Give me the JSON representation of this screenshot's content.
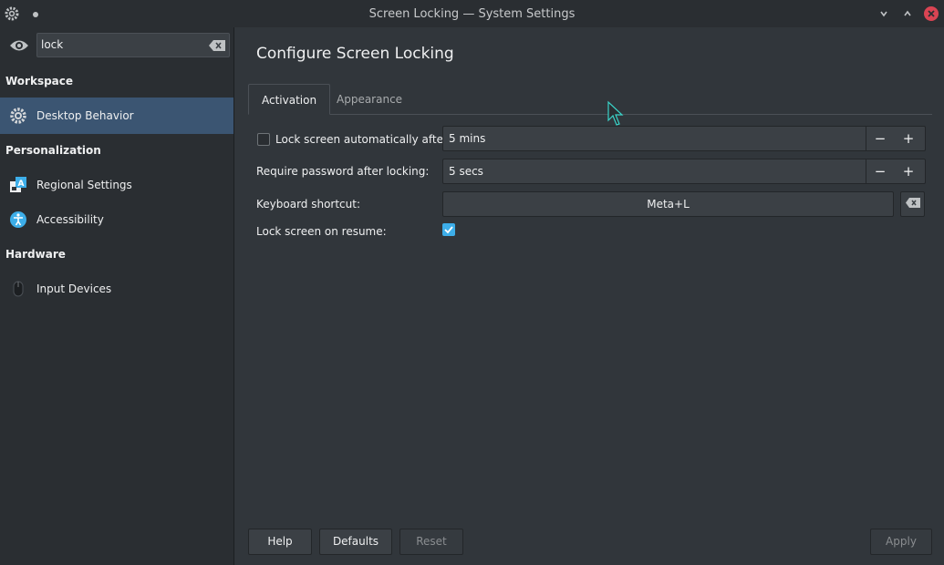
{
  "window": {
    "title": "Screen Locking — System Settings"
  },
  "search": {
    "value": "lock"
  },
  "sidebar": {
    "categories": [
      {
        "label": "Workspace"
      },
      {
        "label": "Personalization"
      },
      {
        "label": "Hardware"
      }
    ],
    "items": [
      {
        "label": "Desktop Behavior",
        "icon": "gear-icon",
        "selected": true
      },
      {
        "label": "Regional Settings",
        "icon": "regional-icon"
      },
      {
        "label": "Accessibility",
        "icon": "accessibility-icon"
      },
      {
        "label": "Input Devices",
        "icon": "mouse-icon"
      }
    ]
  },
  "main": {
    "title": "Configure Screen Locking",
    "tabs": [
      {
        "label": "Activation",
        "active": true
      },
      {
        "label": "Appearance"
      }
    ],
    "lock_auto": {
      "label": "Lock screen automatically after:",
      "checked": false,
      "value": "5 mins"
    },
    "require_password": {
      "label": "Require password after locking:",
      "value": "5 secs"
    },
    "keyboard_shortcut": {
      "label": "Keyboard shortcut:",
      "value": "Meta+L"
    },
    "lock_on_resume": {
      "label": "Lock screen on resume:",
      "checked": true
    },
    "spin_minus": "−",
    "spin_plus": "+"
  },
  "footer": {
    "help": "Help",
    "defaults": "Defaults",
    "reset": "Reset",
    "apply": "Apply"
  },
  "colors": {
    "accent": "#3daee9",
    "selection": "#3b5572",
    "close": "#da4453"
  }
}
